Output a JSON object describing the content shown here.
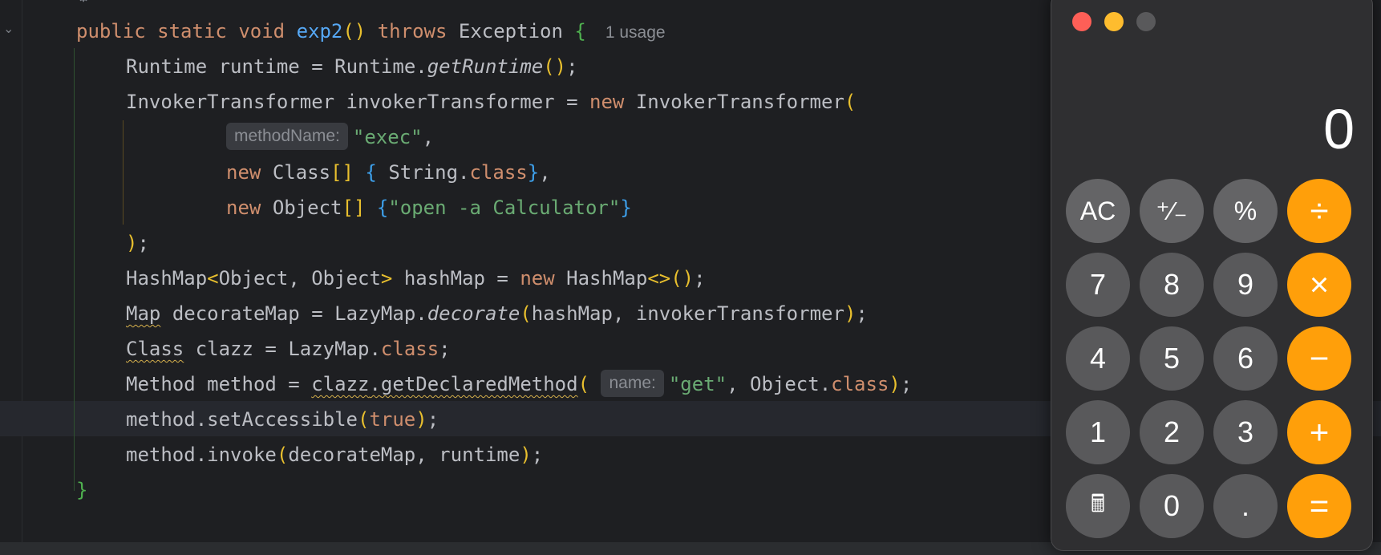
{
  "editor": {
    "usage_hint": "1 usage",
    "hint_method_name": "methodName:",
    "hint_name": "name:",
    "tokens": {
      "public": "public",
      "static": "static",
      "void": "void",
      "exp2": "exp2",
      "throws": "throws",
      "Exception": "Exception",
      "new": "new",
      "true": "true",
      "class": "class",
      "Runtime": "Runtime",
      "runtime": "runtime",
      "getRuntime": "getRuntime",
      "InvokerTransformer": "InvokerTransformer",
      "invokerTransformer": "invokerTransformer",
      "exec": "\"exec\"",
      "Class": "Class",
      "String": "String",
      "Object": "Object",
      "open_calc": "\"open -a Calculator\"",
      "HashMap": "HashMap",
      "hashMap": "hashMap",
      "Map": "Map",
      "decorateMap": "decorateMap",
      "LazyMap": "LazyMap",
      "decorate": "decorate",
      "clazz": "clazz",
      "Method": "Method",
      "method": "method",
      "getDeclaredMethod": "getDeclaredMethod",
      "get": "\"get\"",
      "setAccessible": "setAccessible",
      "invoke": "invoke"
    }
  },
  "calculator": {
    "display": "0",
    "keys": [
      {
        "name": "ac-button",
        "label": "AC",
        "kind": "fn-key"
      },
      {
        "name": "plus-minus-button",
        "label": "⁺∕₋",
        "kind": "fn-key"
      },
      {
        "name": "percent-button",
        "label": "%",
        "kind": "fn-key"
      },
      {
        "name": "divide-button",
        "label": "÷",
        "kind": "op"
      },
      {
        "name": "key-7",
        "label": "7",
        "kind": "num"
      },
      {
        "name": "key-8",
        "label": "8",
        "kind": "num"
      },
      {
        "name": "key-9",
        "label": "9",
        "kind": "num"
      },
      {
        "name": "multiply-button",
        "label": "×",
        "kind": "op"
      },
      {
        "name": "key-4",
        "label": "4",
        "kind": "num"
      },
      {
        "name": "key-5",
        "label": "5",
        "kind": "num"
      },
      {
        "name": "key-6",
        "label": "6",
        "kind": "num"
      },
      {
        "name": "minus-button",
        "label": "−",
        "kind": "op"
      },
      {
        "name": "key-1",
        "label": "1",
        "kind": "num"
      },
      {
        "name": "key-2",
        "label": "2",
        "kind": "num"
      },
      {
        "name": "key-3",
        "label": "3",
        "kind": "num"
      },
      {
        "name": "plus-button",
        "label": "+",
        "kind": "op"
      },
      {
        "name": "calculator-icon",
        "label": "🖩",
        "kind": "num small"
      },
      {
        "name": "key-0",
        "label": "0",
        "kind": "num"
      },
      {
        "name": "decimal-button",
        "label": ".",
        "kind": "num"
      },
      {
        "name": "equals-button",
        "label": "=",
        "kind": "op"
      }
    ]
  }
}
